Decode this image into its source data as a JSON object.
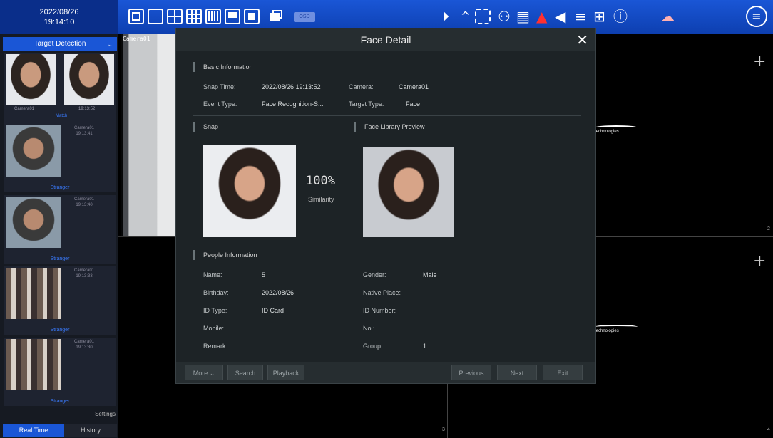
{
  "topbar": {
    "date": "2022/08/26",
    "time": "19:14:10",
    "osd_label": "OSD",
    "icons": [
      "layout-1x1-icon",
      "layout-single-icon",
      "layout-2x2-icon",
      "layout-3x3-icon",
      "layout-4x4-icon",
      "layout-multi-icon",
      "switch-view-icon",
      "osd-icon",
      "playback-icon",
      "collapse-icon",
      "snapshot-icon",
      "ptz-icon",
      "record-icon",
      "alarm-icon",
      "broadcast-icon",
      "storage-icon",
      "network-icon",
      "info-icon",
      "cloud-icon",
      "menu-icon"
    ]
  },
  "sidebar": {
    "title": "Target Detection",
    "items": [
      {
        "camera": "Camera01",
        "time": "19:13:52",
        "label": "Match"
      },
      {
        "camera": "Camera01",
        "time": "19:13:41",
        "label": "Stranger"
      },
      {
        "camera": "Camera01",
        "time": "19:13:40",
        "label": "Stranger"
      },
      {
        "camera": "Camera01",
        "time": "19:13:33",
        "label": "Stranger"
      },
      {
        "camera": "Camera01",
        "time": "19:13:30",
        "label": "Stranger"
      }
    ],
    "settings": "Settings",
    "tab_realtime": "Real Time",
    "tab_history": "History"
  },
  "cameras": {
    "cam1_label": "Camera01",
    "brand_text": "technologies",
    "channel_numbers": [
      "2",
      "3",
      "4"
    ]
  },
  "modal": {
    "title": "Face Detail",
    "basic_title": "Basic Information",
    "snap_time_label": "Snap Time:",
    "snap_time_value": "2022/08/26 19:13:52",
    "camera_label": "Camera:",
    "camera_value": "Camera01",
    "event_type_label": "Event Type:",
    "event_type_value": "Face Recognition-S...",
    "target_type_label": "Target Type:",
    "target_type_value": "Face",
    "snap_title": "Snap",
    "library_title": "Face Library Preview",
    "similarity_value": "100%",
    "similarity_label": "Similarity",
    "people_title": "People Information",
    "name_label": "Name:",
    "name_value": "5",
    "gender_label": "Gender:",
    "gender_value": "Male",
    "birthday_label": "Birthday:",
    "birthday_value": "2022/08/26",
    "native_place_label": "Native Place:",
    "native_place_value": "",
    "id_type_label": "ID Type:",
    "id_type_value": "ID Card",
    "id_number_label": "ID Number:",
    "id_number_value": "",
    "mobile_label": "Mobile:",
    "mobile_value": "",
    "no_label": "No.:",
    "no_value": "",
    "remark_label": "Remark:",
    "remark_value": "",
    "group_label": "Group:",
    "group_value": "1",
    "buttons": {
      "more": "More",
      "search": "Search",
      "playback": "Playback",
      "previous": "Previous",
      "next": "Next",
      "exit": "Exit"
    }
  }
}
